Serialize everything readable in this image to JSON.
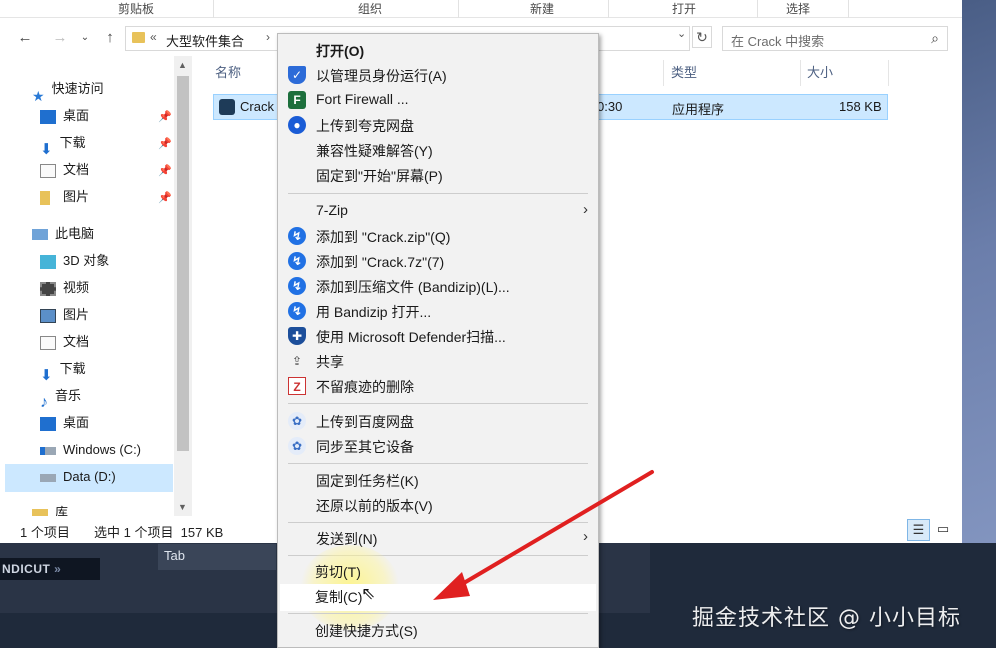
{
  "ribbon": {
    "groups": [
      "剪贴板",
      "组织",
      "新建",
      "打开",
      "选择"
    ]
  },
  "address": {
    "crumb": "大型软件集合",
    "crumb_tail": "",
    "chevron": "«",
    "separator": "›",
    "search_placeholder": "在 Crack 中搜索"
  },
  "nav": {
    "items": [
      {
        "label": "快速访问",
        "icon": "star-icon"
      },
      {
        "label": "桌面",
        "icon": "desktop-icon"
      },
      {
        "label": "下载",
        "icon": "download-icon"
      },
      {
        "label": "文档",
        "icon": "document-icon"
      },
      {
        "label": "图片",
        "icon": "folder-icon"
      },
      {
        "label": "此电脑",
        "icon": "pc-icon"
      },
      {
        "label": "3D 对象",
        "icon": "cube-icon"
      },
      {
        "label": "视频",
        "icon": "video-icon"
      },
      {
        "label": "图片",
        "icon": "picture-icon"
      },
      {
        "label": "文档",
        "icon": "document-icon"
      },
      {
        "label": "下载",
        "icon": "download-icon"
      },
      {
        "label": "音乐",
        "icon": "music-icon"
      },
      {
        "label": "桌面",
        "icon": "desktop-icon"
      },
      {
        "label": "Windows (C:)",
        "icon": "drive-icon"
      },
      {
        "label": "Data (D:)",
        "icon": "drive-icon"
      },
      {
        "label": "库",
        "icon": "library-icon"
      }
    ]
  },
  "files": {
    "columns": {
      "name": "名称",
      "type": "类型",
      "size": "大小"
    },
    "row": {
      "name": "Crack",
      "date": "0:30",
      "type": "应用程序",
      "size": "158 KB"
    }
  },
  "status": {
    "count": "1 个项目",
    "selected": "选中 1 个项目  157 KB"
  },
  "context_menu": {
    "items": [
      {
        "label": "打开(O)",
        "bold": true
      },
      {
        "label": "以管理员身份运行(A)"
      },
      {
        "label": "Fort Firewall ..."
      },
      {
        "label": "上传到夸克网盘"
      },
      {
        "label": "兼容性疑难解答(Y)"
      },
      {
        "label": "固定到\"开始\"屏幕(P)"
      },
      {
        "label": "7-Zip",
        "submenu": true
      },
      {
        "label": "添加到 \"Crack.zip\"(Q)"
      },
      {
        "label": "添加到 \"Crack.7z\"(7)"
      },
      {
        "label": "添加到压缩文件 (Bandizip)(L)..."
      },
      {
        "label": "用 Bandizip 打开..."
      },
      {
        "label": "使用 Microsoft Defender扫描..."
      },
      {
        "label": "共享"
      },
      {
        "label": "不留痕迹的删除"
      },
      {
        "label": "上传到百度网盘"
      },
      {
        "label": "同步至其它设备"
      },
      {
        "label": "固定到任务栏(K)"
      },
      {
        "label": "还原以前的版本(V)"
      },
      {
        "label": "发送到(N)",
        "submenu": true
      },
      {
        "label": "剪切(T)"
      },
      {
        "label": "复制(C)"
      },
      {
        "label": "创建快捷方式(S)"
      }
    ]
  },
  "taskbar": {
    "app_logo": "NDICUT",
    "tab_label": "Tab"
  },
  "watermark": "掘金技术社区 @ 小小目标",
  "colors": {
    "selection": "#cce8ff",
    "arrow": "#e02020",
    "menu_bg": "#f2f2f2"
  }
}
